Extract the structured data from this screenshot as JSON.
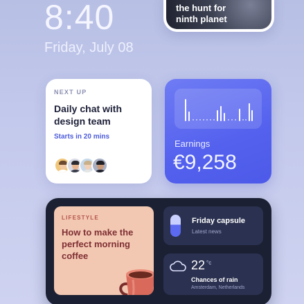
{
  "lockscreen": {
    "time": "8:40",
    "date": "Friday, July 08"
  },
  "planet_card": {
    "title_line1": "the hunt for",
    "title_line2": "ninth planet"
  },
  "meeting_card": {
    "kicker": "NEXT UP",
    "title": "Daily chat with design team",
    "subtitle": "Starts in 20 mins",
    "avatars": [
      "avatar-1",
      "avatar-2",
      "avatar-3",
      "avatar-4"
    ]
  },
  "earnings_card": {
    "label": "Earnings",
    "value": "€9,258",
    "accent": "#5461ee"
  },
  "lifestyle_card": {
    "kicker": "LIFESTYLE",
    "title": "How to make the perfect morning coffee",
    "icon": "coffee-cup-icon"
  },
  "capsule_card": {
    "title": "Friday capsule",
    "subtitle": "Latest news",
    "icon": "capsule-icon"
  },
  "weather_card": {
    "temperature": "22",
    "unit": "°c",
    "condition": "Chances of rain",
    "location": "Amsterdam, Netherlands",
    "icon": "cloud-icon"
  }
}
